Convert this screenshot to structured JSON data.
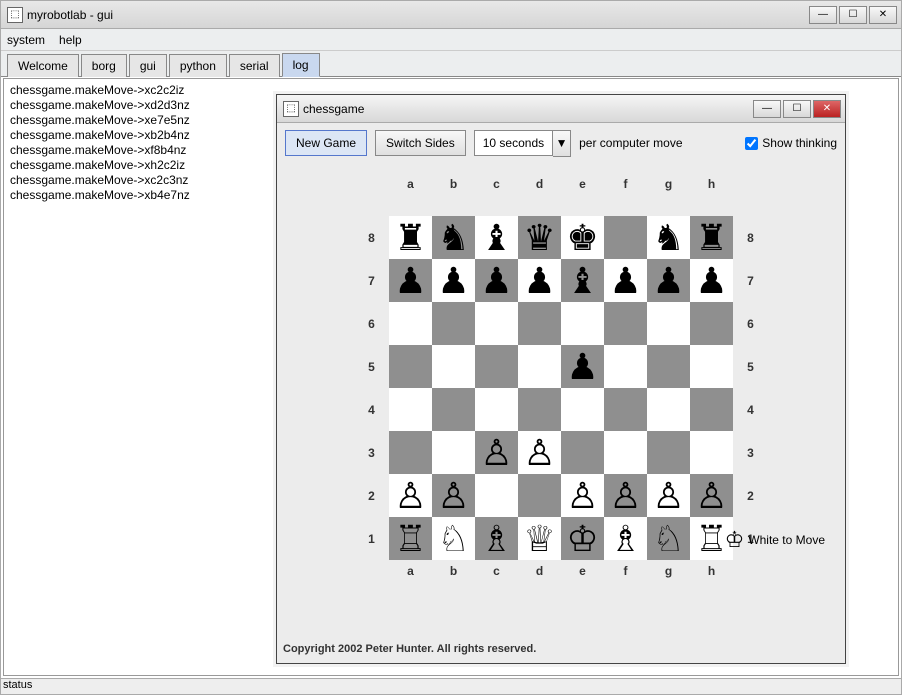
{
  "main_window": {
    "title": "myrobotlab - gui",
    "menu": {
      "system": "system",
      "help": "help"
    },
    "tabs": [
      "Welcome",
      "borg",
      "gui",
      "python",
      "serial",
      "log"
    ],
    "active_tab": "log",
    "log_lines": [
      "chessgame.makeMove->xc2c2iz",
      "chessgame.makeMove->xd2d3nz",
      "chessgame.makeMove->xe7e5nz",
      "chessgame.makeMove->xb2b4nz",
      "chessgame.makeMove->xf8b4nz",
      "chessgame.makeMove->xh2c2iz",
      "chessgame.makeMove->xc2c3nz",
      "chessgame.makeMove->xb4e7nz"
    ],
    "status": "status"
  },
  "chess_window": {
    "title": "chessgame",
    "toolbar": {
      "new_game": "New Game",
      "switch_sides": "Switch Sides",
      "time_value": "10 seconds",
      "per_move_label": "per computer move",
      "show_thinking_label": "Show thinking",
      "show_thinking_checked": true
    },
    "copyright": "Copyright 2002 Peter Hunter. All rights reserved.",
    "turn_label": "White to Move",
    "files": [
      "a",
      "b",
      "c",
      "d",
      "e",
      "f",
      "g",
      "h"
    ],
    "ranks": [
      "8",
      "7",
      "6",
      "5",
      "4",
      "3",
      "2",
      "1"
    ],
    "board": [
      [
        "♜",
        "♞",
        "♝",
        "♛",
        "♚",
        "",
        "♞",
        "♜"
      ],
      [
        "♟",
        "♟",
        "♟",
        "♟",
        "♝",
        "♟",
        "♟",
        "♟"
      ],
      [
        "",
        "",
        "",
        "",
        "",
        "",
        "",
        ""
      ],
      [
        "",
        "",
        "",
        "",
        "♟",
        "",
        "",
        ""
      ],
      [
        "",
        "",
        "",
        "",
        "",
        "",
        "",
        ""
      ],
      [
        "",
        "",
        "♙",
        "♙",
        "",
        "",
        "",
        ""
      ],
      [
        "♙",
        "♙",
        "",
        "",
        "♙",
        "♙",
        "♙",
        "♙"
      ],
      [
        "♖",
        "♘",
        "♗",
        "♕",
        "♔",
        "♗",
        "♘",
        "♖"
      ]
    ]
  }
}
